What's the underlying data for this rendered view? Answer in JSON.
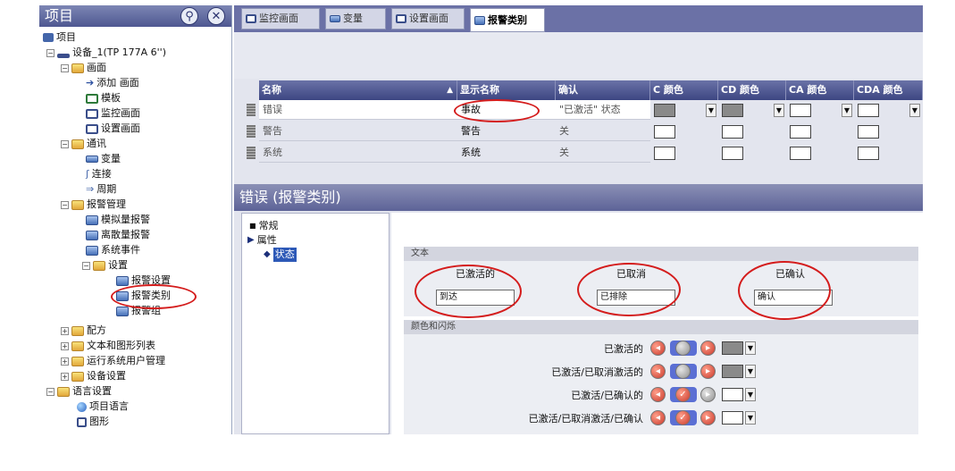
{
  "left_panel": {
    "title": "项目",
    "root": "项目",
    "device": "设备_1(TP 177A 6'')",
    "items": {
      "screens": "画面",
      "add_screen": "添加 画面",
      "template": "模板",
      "monitor_screen": "监控画面",
      "setup_screen": "设置画面",
      "comm": "通讯",
      "tags": "变量",
      "connections": "连接",
      "cycles": "周期",
      "alarm_mgmt": "报警管理",
      "analog_alarms": "模拟量报警",
      "discrete_alarms": "离散量报警",
      "system_events": "系统事件",
      "settings": "设置",
      "alarm_settings": "报警设置",
      "alarm_classes": "报警类别",
      "alarm_groups": "报警组",
      "recipes": "配方",
      "text_graphic_lists": "文本和图形列表",
      "runtime_user_admin": "运行系统用户管理",
      "device_settings": "设备设置",
      "language_settings": "语言设置",
      "project_languages": "项目语言",
      "graphics": "图形"
    }
  },
  "tabs": [
    "监控画面",
    "变量",
    "设置画面",
    "报警类别"
  ],
  "grid": {
    "headers": [
      "名称",
      "显示名称",
      "确认",
      "C 颜色",
      "CD 颜色",
      "CA 颜色",
      "CDA 颜色"
    ],
    "rows": [
      {
        "name": "错误",
        "display": "事故",
        "ack": "\"已激活\" 状态"
      },
      {
        "name": "警告",
        "display": "警告",
        "ack": "关"
      },
      {
        "name": "系统",
        "display": "系统",
        "ack": "关"
      }
    ]
  },
  "properties": {
    "title": "错误 (报警类别)",
    "nav": {
      "general": "常规",
      "properties": "属性",
      "state": "状态"
    },
    "text_section": {
      "header": "文本",
      "col1_label": "已激活的",
      "col2_label": "已取消",
      "col3_label": "已确认",
      "col1_value": "到达",
      "col2_value": "已排除",
      "col3_value": "确认"
    },
    "color_section": {
      "header": "颜色和闪烁",
      "rows": [
        "已激活的",
        "已激活/已取消激活的",
        "已激活/已确认的",
        "已激活/已取消激活/已确认"
      ]
    }
  },
  "colors": {
    "accent": "#4e5791",
    "highlight_oval": "#d41c1c"
  }
}
